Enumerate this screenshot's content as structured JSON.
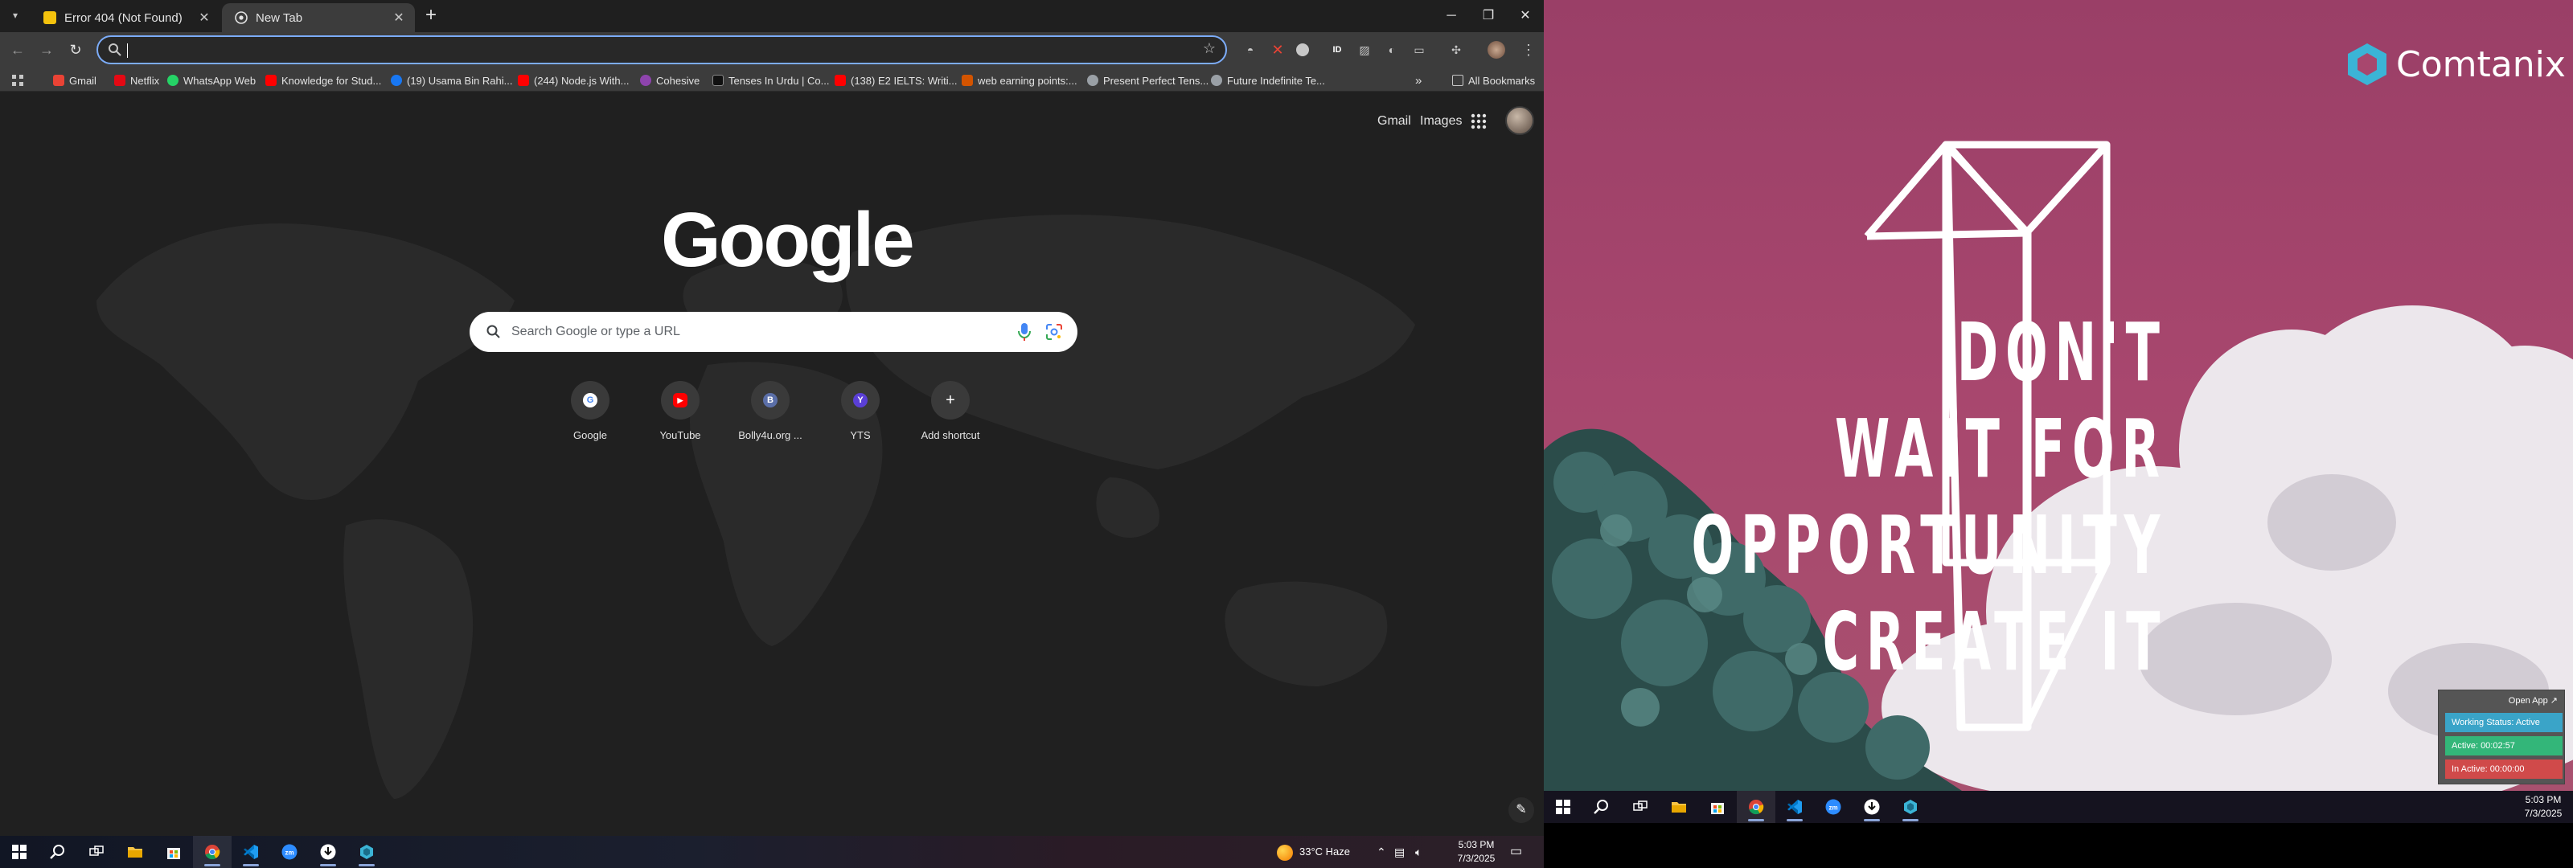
{
  "browser": {
    "tabs": [
      {
        "title": "Error 404 (Not Found)",
        "active": false
      },
      {
        "title": "New Tab",
        "active": true
      }
    ],
    "omnibox": {
      "value": "",
      "placeholder": ""
    },
    "bookmarks": [
      {
        "label": "Gmail",
        "color": "#ea4335"
      },
      {
        "label": "Netflix",
        "color": "#e50914"
      },
      {
        "label": "WhatsApp Web",
        "color": "#25d366"
      },
      {
        "label": "Knowledge for Stud...",
        "color": "#ff0000"
      },
      {
        "label": "(19) Usama Bin Rahi...",
        "color": "#1877f2"
      },
      {
        "label": "(244) Node.js With...",
        "color": "#ff0000"
      },
      {
        "label": "Cohesive",
        "color": "#8e44ad"
      },
      {
        "label": "Tenses In Urdu | Co...",
        "color": "#222222"
      },
      {
        "label": "(138) E2 IELTS: Writi...",
        "color": "#ff0000"
      },
      {
        "label": "web earning points:...",
        "color": "#d35400"
      },
      {
        "label": "Present Perfect Tens...",
        "color": "#9aa0a6"
      },
      {
        "label": "Future Indefinite Te...",
        "color": "#9aa0a6"
      }
    ],
    "all_bookmarks": "All Bookmarks",
    "more_bookmarks": "»"
  },
  "ntp": {
    "gmail": "Gmail",
    "images": "Images",
    "logo": "Google",
    "search_placeholder": "Search Google or type a URL",
    "shortcuts": [
      {
        "label": "Google",
        "glyph": "G",
        "color": "#4285f4"
      },
      {
        "label": "YouTube",
        "glyph": "▶",
        "color": "#ff0000"
      },
      {
        "label": "Bolly4u.org ...",
        "glyph": "B",
        "color": "#5b6fa8"
      },
      {
        "label": "YTS",
        "glyph": "Y",
        "color": "#5a3fd6"
      },
      {
        "label": "Add shortcut",
        "glyph": "+",
        "color": "#3a3a3a"
      }
    ]
  },
  "taskbar1": {
    "weather": "33°C  Haze",
    "time": "5:03 PM",
    "date": "7/3/2025"
  },
  "desktop2": {
    "brand": "Comtanix",
    "quote": [
      "DON'T",
      "WAIT FOR",
      "OPPORTUNITY",
      "CREATE IT"
    ],
    "widget": {
      "open_app": "Open App ↗",
      "working_status": "Working Status: Active",
      "active": "Active: 00:02:57",
      "inactive": "In Active: 00:00:00"
    },
    "time": "5:03 PM",
    "date": "7/3/2025"
  }
}
